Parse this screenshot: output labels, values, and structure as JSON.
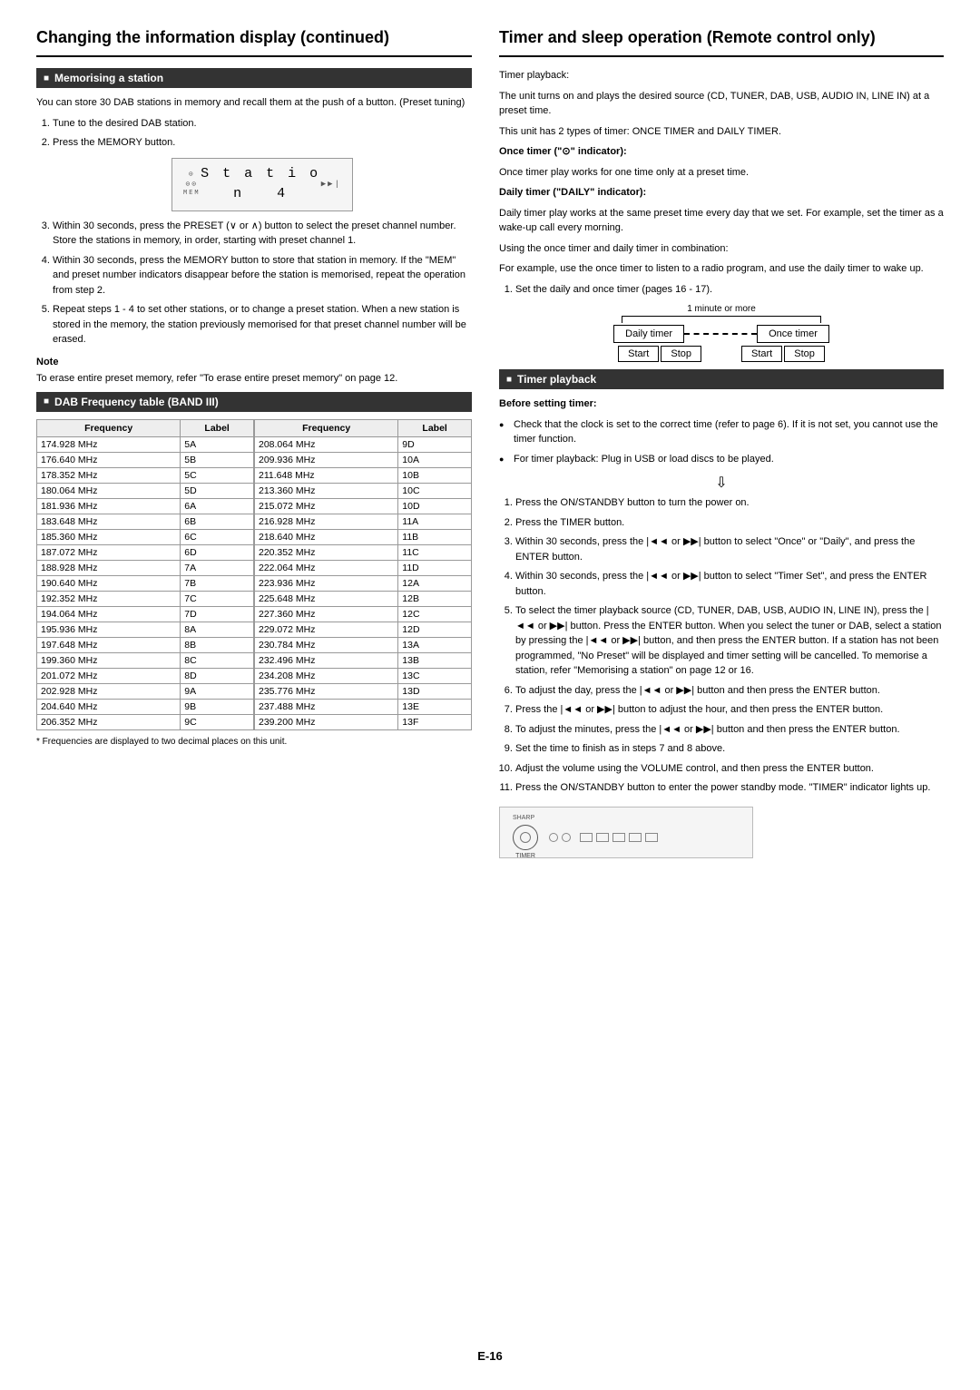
{
  "left": {
    "title": "Changing the information display (continued)",
    "section1": {
      "header": "Memorising a station",
      "intro": "You can store 30 DAB stations in memory and recall them at the push of a button. (Preset tuning)",
      "station_display": "S t a t i o n   4",
      "steps": [
        "Tune to the desired DAB station.",
        "Press the MEMORY button.",
        "Within 30 seconds, press the PRESET (∨ or ∧) button to select the preset channel number. Store the stations in memory, in order, starting with preset channel 1.",
        "Within 30 seconds, press the MEMORY button to store that station in memory. If the \"MEM\" and preset number indicators disappear before the station is memorised, repeat the operation from step 2.",
        "Repeat steps 1 - 4 to set other stations, or to change a preset station. When a new station is stored in the memory, the station previously memorised for that preset channel number will be erased."
      ],
      "note_label": "Note",
      "note_text": "To erase entire preset memory, refer \"To erase entire preset memory\" on page 12."
    },
    "section2": {
      "header": "DAB Frequency table (BAND III)",
      "columns": [
        "Frequency",
        "Label",
        "Frequency",
        "Label"
      ],
      "rows_left": [
        [
          "174.928 MHz",
          "5A"
        ],
        [
          "176.640 MHz",
          "5B"
        ],
        [
          "178.352 MHz",
          "5C"
        ],
        [
          "180.064 MHz",
          "5D"
        ],
        [
          "181.936 MHz",
          "6A"
        ],
        [
          "183.648 MHz",
          "6B"
        ],
        [
          "185.360 MHz",
          "6C"
        ],
        [
          "187.072 MHz",
          "6D"
        ],
        [
          "188.928 MHz",
          "7A"
        ],
        [
          "190.640 MHz",
          "7B"
        ],
        [
          "192.352 MHz",
          "7C"
        ],
        [
          "194.064 MHz",
          "7D"
        ],
        [
          "195.936 MHz",
          "8A"
        ],
        [
          "197.648 MHz",
          "8B"
        ],
        [
          "199.360 MHz",
          "8C"
        ],
        [
          "201.072 MHz",
          "8D"
        ],
        [
          "202.928 MHz",
          "9A"
        ],
        [
          "204.640 MHz",
          "9B"
        ],
        [
          "206.352 MHz",
          "9C"
        ]
      ],
      "rows_right": [
        [
          "208.064 MHz",
          "9D"
        ],
        [
          "209.936 MHz",
          "10A"
        ],
        [
          "211.648 MHz",
          "10B"
        ],
        [
          "213.360 MHz",
          "10C"
        ],
        [
          "215.072 MHz",
          "10D"
        ],
        [
          "216.928 MHz",
          "11A"
        ],
        [
          "218.640 MHz",
          "11B"
        ],
        [
          "220.352 MHz",
          "11C"
        ],
        [
          "222.064 MHz",
          "11D"
        ],
        [
          "223.936 MHz",
          "12A"
        ],
        [
          "225.648 MHz",
          "12B"
        ],
        [
          "227.360 MHz",
          "12C"
        ],
        [
          "229.072 MHz",
          "12D"
        ],
        [
          "230.784 MHz",
          "13A"
        ],
        [
          "232.496 MHz",
          "13B"
        ],
        [
          "234.208 MHz",
          "13C"
        ],
        [
          "235.776 MHz",
          "13D"
        ],
        [
          "237.488 MHz",
          "13E"
        ],
        [
          "239.200 MHz",
          "13F"
        ]
      ],
      "footnote": "* Frequencies are displayed to two decimal places on this unit."
    }
  },
  "right": {
    "title": "Timer and sleep operation (Remote control only)",
    "timer_playback_label": "Timer playback:",
    "intro1": "The unit turns on and plays the desired source (CD, TUNER, DAB, USB, AUDIO IN, LINE IN) at a preset time.",
    "intro2": "This unit has 2 types of timer: ONCE TIMER and DAILY TIMER.",
    "once_timer_label": "Once timer (\"⊙\" indicator):",
    "once_timer_text": "Once timer play works for one time only at a preset time.",
    "daily_timer_label": "Daily timer (\"DAILY\" indicator):",
    "daily_timer_text": "Daily timer play works at the same preset time every day that we set. For example, set the timer as a wake-up call every morning.",
    "combo_label": "Using the once timer and daily timer in combination:",
    "combo_text": "For example, use the once timer to listen to a radio program, and use the daily timer to wake up.",
    "step1": "Set the daily and once timer (pages 16 - 17).",
    "diagram": {
      "top_label": "1 minute or more",
      "daily_label": "Daily timer",
      "once_label": "Once timer",
      "start_label": "Start",
      "stop_label": "Stop",
      "start2_label": "Start",
      "stop2_label": "Stop"
    },
    "section_timer": {
      "header": "Timer playback",
      "before_label": "Before setting timer:",
      "bullets": [
        "Check that the clock is set to the correct time (refer to page 6). If it is not set, you cannot use the timer function.",
        "For timer playback: Plug in USB or load discs to be played."
      ],
      "steps": [
        "Press the ON/STANDBY button to turn the power on.",
        "Press the TIMER button.",
        "Within 30 seconds, press the |◄◄ or ▶▶| button to select \"Once\" or \"Daily\", and press the ENTER button.",
        "Within 30 seconds, press the |◄◄ or ▶▶| button to select \"Timer Set\", and press the ENTER button.",
        "To select the timer playback source (CD, TUNER, DAB, USB, AUDIO IN, LINE IN), press the |◄◄ or ▶▶| button. Press the ENTER button.\nWhen you select the tuner or DAB, select a station by pressing the |◄◄ or ▶▶| button, and then press the ENTER button. If a station has not been programmed, \"No Preset\" will be displayed and timer setting will be cancelled. To memorise a station, refer \"Memorising a station\" on page 12 or 16.",
        "To adjust the day, press the |◄◄ or ▶▶| button and then press the ENTER button.",
        "Press the |◄◄ or ▶▶| button to adjust the hour, and then press the ENTER button.",
        "To adjust the minutes, press the |◄◄ or ▶▶| button and then press the ENTER button.",
        "Set the time to finish as in steps 7 and 8 above.",
        "Adjust the volume using the VOLUME control, and then press the ENTER button.",
        "Press the ON/STANDBY button to enter the power standby mode. \"TIMER\" indicator lights up."
      ]
    },
    "page_number": "E-16"
  }
}
